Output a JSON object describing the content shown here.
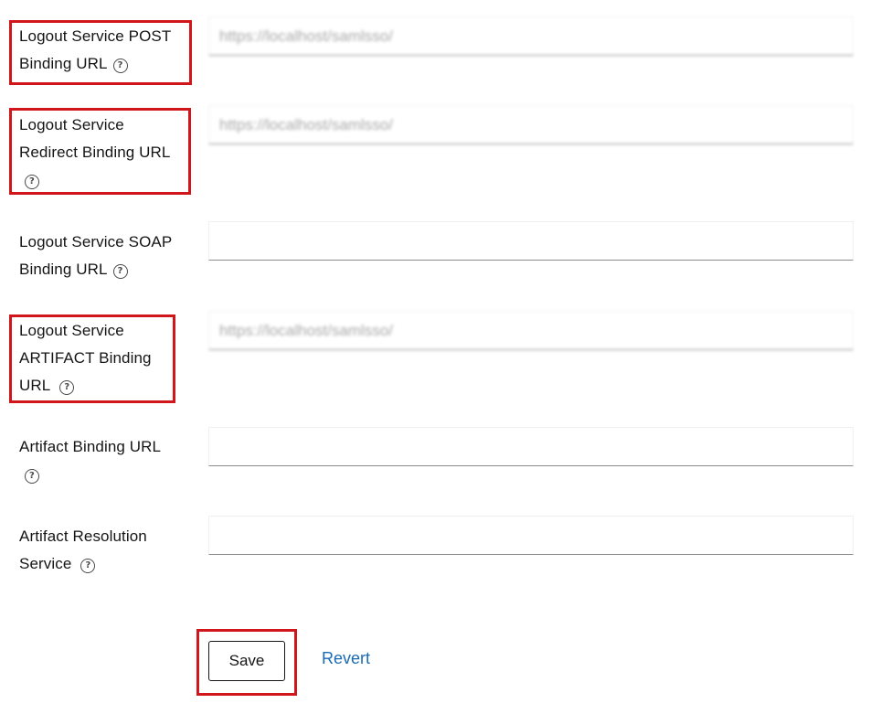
{
  "form": {
    "fields": [
      {
        "label_line1": "Logout Service POST",
        "label_line2": "Binding URL",
        "help_icon": "question-circle-icon",
        "value": "https://localhost/samlsso/",
        "highlighted": true
      },
      {
        "label_line1": "Logout Service",
        "label_line2": "Redirect Binding URL",
        "help_icon": "question-circle-icon",
        "value": "https://localhost/samlsso/",
        "highlighted": true
      },
      {
        "label_line1": "Logout Service SOAP",
        "label_line2": "Binding URL",
        "help_icon": "question-circle-icon",
        "value": "",
        "highlighted": false
      },
      {
        "label_line1": "Logout Service",
        "label_line2": "ARTIFACT Binding",
        "label_line3": "URL",
        "help_icon": "question-circle-icon",
        "value": "https://localhost/samlsso/",
        "highlighted": true
      },
      {
        "label_line1": "Artifact Binding URL",
        "help_icon": "question-circle-icon",
        "value": "",
        "highlighted": false
      },
      {
        "label_line1": "Artifact Resolution",
        "label_line2": "Service",
        "help_icon": "question-circle-icon",
        "value": "",
        "highlighted": false
      }
    ]
  },
  "actions": {
    "save_label": "Save",
    "revert_label": "Revert",
    "save_highlighted": true
  },
  "colors": {
    "highlight": "#d0161b",
    "link": "#1a6bb4",
    "text": "#151515",
    "input_border": "#8a8d90"
  }
}
